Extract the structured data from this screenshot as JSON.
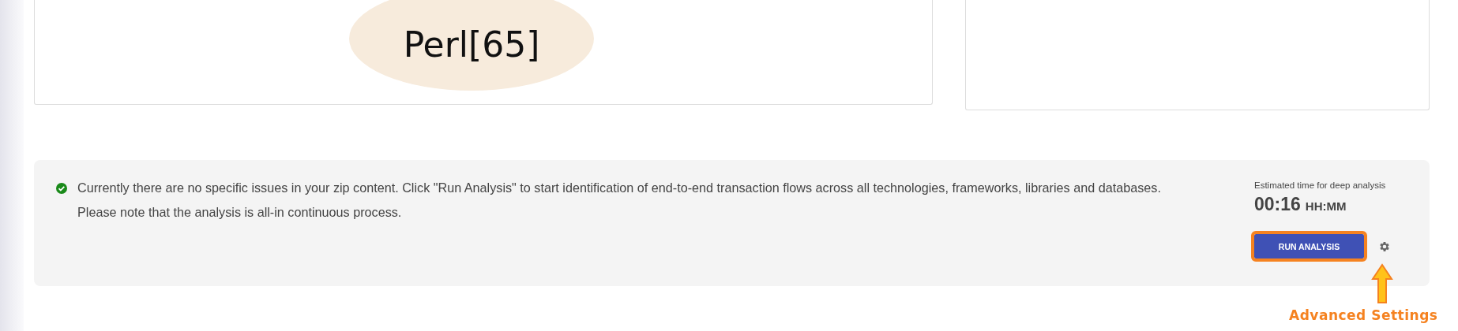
{
  "diagram_card": {
    "node": {
      "label": "Perl[65]"
    }
  },
  "status_panel": {
    "success": true,
    "messages": [
      "Currently there are no specific issues in your zip content. Click \"Run Analysis\" to start identification of end-to-end transaction flows across all technologies, frameworks, libraries and databases.",
      "Please note that the analysis is all-in continuous process."
    ],
    "estimate_label": "Estimated time for deep analysis",
    "estimate_value": "00:16",
    "estimate_unit": "HH:MM",
    "run_button": {
      "label": "RUN ANALYSIS"
    }
  },
  "annotation": {
    "label": "Advanced Settings"
  }
}
